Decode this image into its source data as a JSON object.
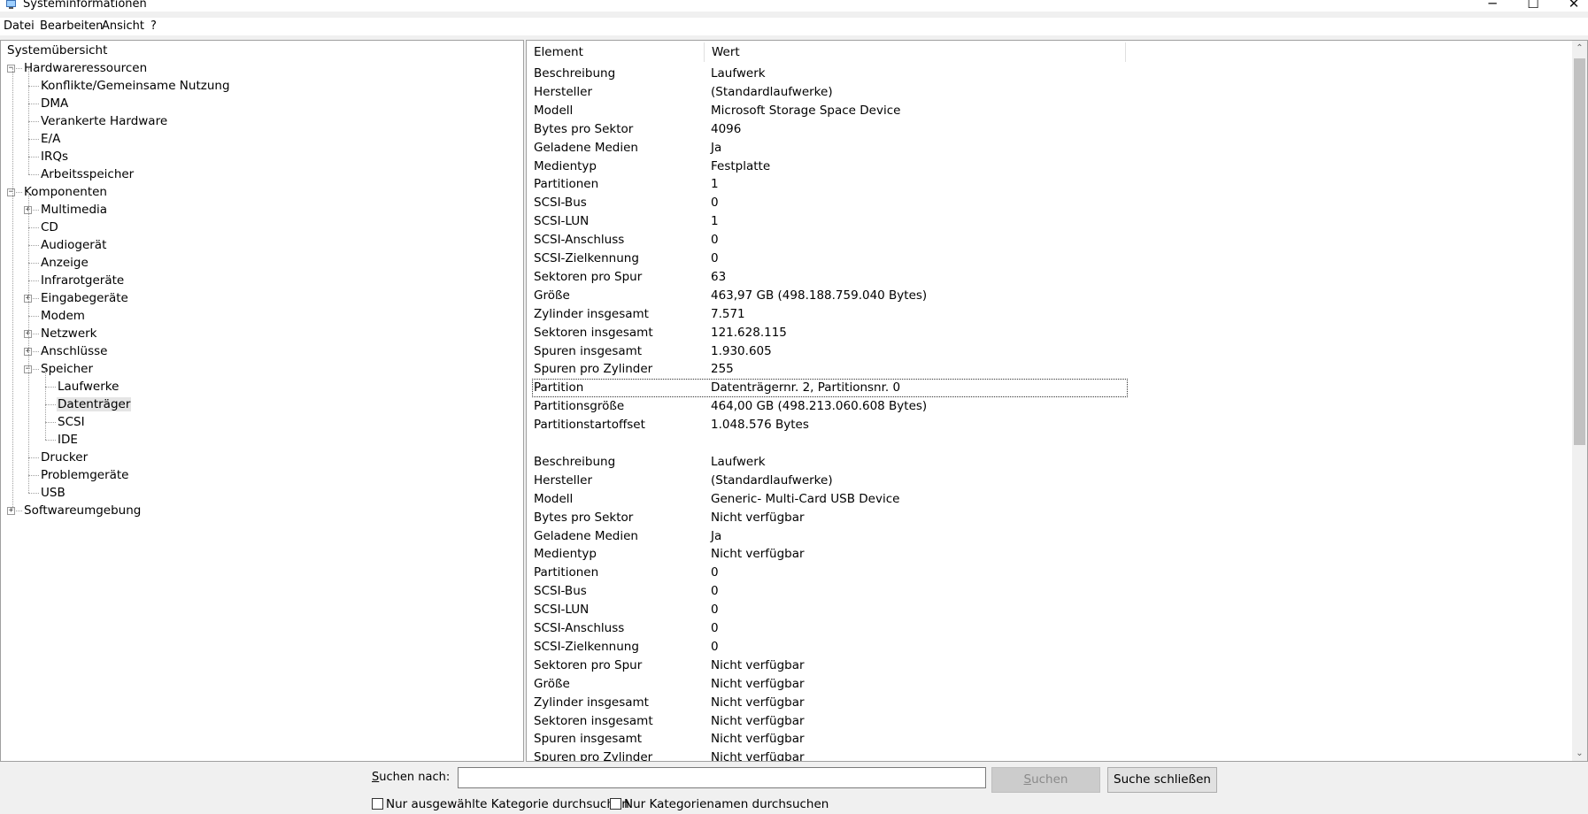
{
  "window": {
    "title": "Systeminformationen",
    "controls": {
      "minimize": "─",
      "maximize": "☐",
      "close": "✕"
    }
  },
  "menu": [
    "Datei",
    "Bearbeiten",
    "Ansicht",
    "?"
  ],
  "tree": [
    {
      "label": "Systemübersicht",
      "level": 0,
      "expander": null
    },
    {
      "label": "Hardwareressourcen",
      "level": 1,
      "expander": "minus"
    },
    {
      "label": "Konflikte/Gemeinsame Nutzung",
      "level": 2,
      "expander": null
    },
    {
      "label": "DMA",
      "level": 2,
      "expander": null
    },
    {
      "label": "Verankerte Hardware",
      "level": 2,
      "expander": null
    },
    {
      "label": "E/A",
      "level": 2,
      "expander": null
    },
    {
      "label": "IRQs",
      "level": 2,
      "expander": null
    },
    {
      "label": "Arbeitsspeicher",
      "level": 2,
      "expander": null
    },
    {
      "label": "Komponenten",
      "level": 1,
      "expander": "minus"
    },
    {
      "label": "Multimedia",
      "level": 2,
      "expander": "plus"
    },
    {
      "label": "CD",
      "level": 2,
      "expander": null
    },
    {
      "label": "Audiogerät",
      "level": 2,
      "expander": null
    },
    {
      "label": "Anzeige",
      "level": 2,
      "expander": null
    },
    {
      "label": "Infrarotgeräte",
      "level": 2,
      "expander": null
    },
    {
      "label": "Eingabegeräte",
      "level": 2,
      "expander": "plus"
    },
    {
      "label": "Modem",
      "level": 2,
      "expander": null
    },
    {
      "label": "Netzwerk",
      "level": 2,
      "expander": "plus"
    },
    {
      "label": "Anschlüsse",
      "level": 2,
      "expander": "plus"
    },
    {
      "label": "Speicher",
      "level": 2,
      "expander": "minus"
    },
    {
      "label": "Laufwerke",
      "level": 3,
      "expander": null
    },
    {
      "label": "Datenträger",
      "level": 3,
      "expander": null,
      "selected": true
    },
    {
      "label": "SCSI",
      "level": 3,
      "expander": null
    },
    {
      "label": "IDE",
      "level": 3,
      "expander": null
    },
    {
      "label": "Drucker",
      "level": 2,
      "expander": null
    },
    {
      "label": "Problemgeräte",
      "level": 2,
      "expander": null
    },
    {
      "label": "USB",
      "level": 2,
      "expander": null
    },
    {
      "label": "Softwareumgebung",
      "level": 1,
      "expander": "plus"
    }
  ],
  "list": {
    "columns": {
      "element": "Element",
      "value": "Wert"
    },
    "rows": [
      [
        "Beschreibung",
        "Laufwerk"
      ],
      [
        "Hersteller",
        "(Standardlaufwerke)"
      ],
      [
        "Modell",
        "Microsoft Storage Space Device"
      ],
      [
        "Bytes pro Sektor",
        "4096"
      ],
      [
        "Geladene Medien",
        "Ja"
      ],
      [
        "Medientyp",
        "Festplatte"
      ],
      [
        "Partitionen",
        "1"
      ],
      [
        "SCSI-Bus",
        "0"
      ],
      [
        "SCSI-LUN",
        "1"
      ],
      [
        "SCSI-Anschluss",
        "0"
      ],
      [
        "SCSI-Zielkennung",
        "0"
      ],
      [
        "Sektoren pro Spur",
        "63"
      ],
      [
        "Größe",
        "463,97 GB (498.188.759.040 Bytes)"
      ],
      [
        "Zylinder insgesamt",
        "7.571"
      ],
      [
        "Sektoren insgesamt",
        "121.628.115"
      ],
      [
        "Spuren insgesamt",
        "1.930.605"
      ],
      [
        "Spuren pro Zylinder",
        "255"
      ],
      [
        "Partition",
        "Datenträgernr. 2, Partitionsnr. 0"
      ],
      [
        "Partitionsgröße",
        "464,00 GB (498.213.060.608 Bytes)"
      ],
      [
        "Partitionstartoffset",
        "1.048.576 Bytes"
      ],
      [
        "",
        ""
      ],
      [
        "Beschreibung",
        "Laufwerk"
      ],
      [
        "Hersteller",
        "(Standardlaufwerke)"
      ],
      [
        "Modell",
        "Generic- Multi-Card USB Device"
      ],
      [
        "Bytes pro Sektor",
        "Nicht verfügbar"
      ],
      [
        "Geladene Medien",
        "Ja"
      ],
      [
        "Medientyp",
        "Nicht verfügbar"
      ],
      [
        "Partitionen",
        "0"
      ],
      [
        "SCSI-Bus",
        "0"
      ],
      [
        "SCSI-LUN",
        "0"
      ],
      [
        "SCSI-Anschluss",
        "0"
      ],
      [
        "SCSI-Zielkennung",
        "0"
      ],
      [
        "Sektoren pro Spur",
        "Nicht verfügbar"
      ],
      [
        "Größe",
        "Nicht verfügbar"
      ],
      [
        "Zylinder insgesamt",
        "Nicht verfügbar"
      ],
      [
        "Sektoren insgesamt",
        "Nicht verfügbar"
      ],
      [
        "Spuren insgesamt",
        "Nicht verfügbar"
      ],
      [
        "Spuren pro Zylinder",
        "Nicht verfügbar"
      ]
    ],
    "focused_row": 17
  },
  "search": {
    "label": "Suchen nach:",
    "value": "",
    "search_button": "Suchen",
    "close_button": "Suche schließen",
    "option_selected_category": "Nur ausgewählte Kategorie durchsuchen",
    "option_category_names": "Nur Kategorienamen durchsuchen"
  }
}
